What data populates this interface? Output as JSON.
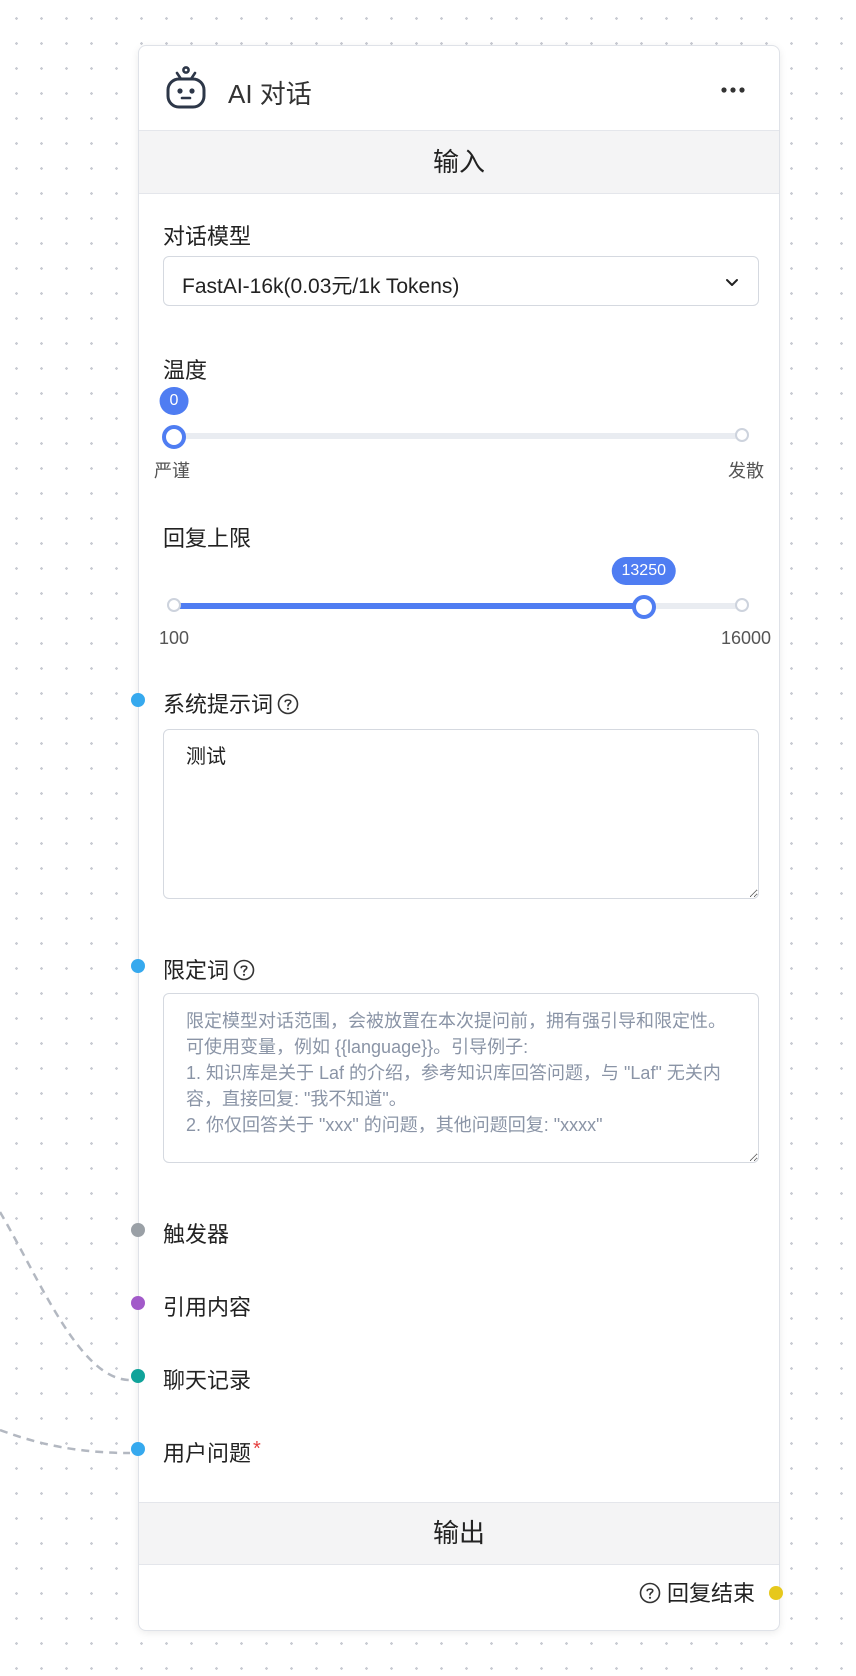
{
  "node": {
    "title": "AI 对话",
    "icon": "robot-icon"
  },
  "sections": {
    "input": "输入",
    "output": "输出"
  },
  "model": {
    "label": "对话模型",
    "value": "FastAI-16k(0.03元/1k Tokens)"
  },
  "temperature": {
    "label": "温度",
    "value": 0,
    "min": 0,
    "max": 10,
    "value_text": "0",
    "min_label": "严谨",
    "max_label": "发散"
  },
  "max_tokens": {
    "label": "回复上限",
    "value": 13250,
    "min": 100,
    "max": 16000,
    "value_text": "13250",
    "min_label": "100",
    "max_label": "16000"
  },
  "system_prompt": {
    "label": "系统提示词",
    "value": "测试"
  },
  "limit_prompt": {
    "label": "限定词",
    "placeholder": "限定模型对话范围，会被放置在本次提问前，拥有强引导和限定性。可使用变量，例如 {{language}}。引导例子:\n1. 知识库是关于 Laf 的介绍，参考知识库回答问题，与 \"Laf\" 无关内容，直接回复: \"我不知道\"。\n2. 你仅回答关于 \"xxx\" 的问题，其他问题回复: \"xxxx\""
  },
  "inputs": {
    "trigger": "触发器",
    "quote": "引用内容",
    "history": "聊天记录",
    "user_question": "用户问题",
    "required_mark": "*"
  },
  "outputs": {
    "finish": "回复结束"
  },
  "colors": {
    "accent": "#4f7df2",
    "port_blue": "#36a9ee",
    "port_gray": "#9aa0a6",
    "port_purple": "#a25ac9",
    "port_teal": "#10a39a",
    "port_yellow": "#e6c81c"
  }
}
